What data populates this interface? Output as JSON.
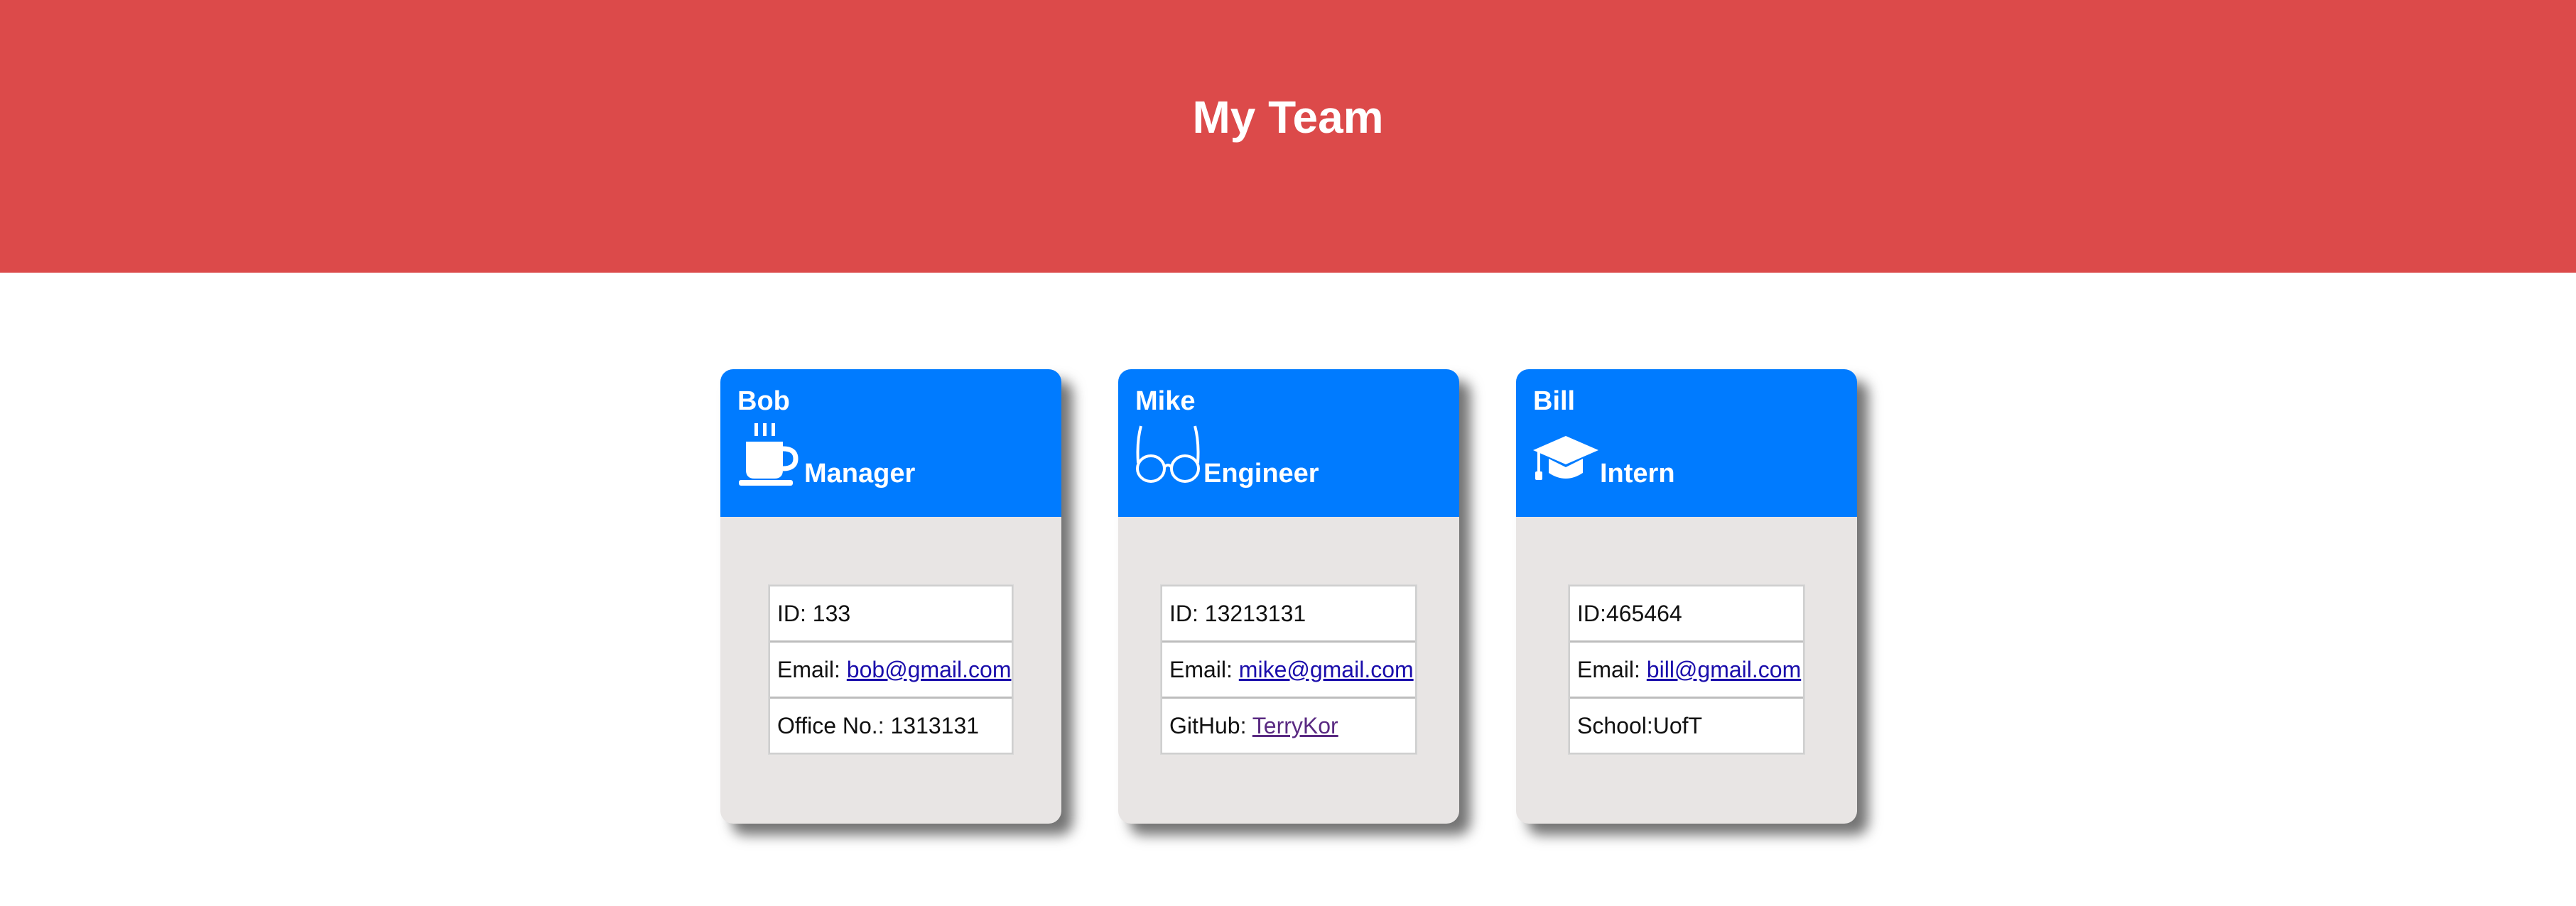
{
  "header": {
    "title": "My Team"
  },
  "cards": [
    {
      "name": "Bob",
      "role": "Manager",
      "icon": "coffee-cup-icon",
      "rows": [
        {
          "label": "ID: ",
          "value": "133",
          "link": false
        },
        {
          "label": "Email: ",
          "value": "bob@gmail.com",
          "link": true
        },
        {
          "label": "Office No.: ",
          "value": "1313131",
          "link": false
        }
      ]
    },
    {
      "name": "Mike",
      "role": "Engineer",
      "icon": "glasses-icon",
      "rows": [
        {
          "label": "ID: ",
          "value": "13213131",
          "link": false
        },
        {
          "label": "Email: ",
          "value": "mike@gmail.com",
          "link": true
        },
        {
          "label": "GitHub: ",
          "value": "TerryKor",
          "link": true
        }
      ]
    },
    {
      "name": "Bill",
      "role": "Intern",
      "icon": "graduation-cap-icon",
      "rows": [
        {
          "label": "ID:",
          "value": "465464",
          "link": false
        },
        {
          "label": "Email: ",
          "value": "bill@gmail.com",
          "link": true
        },
        {
          "label": "School:",
          "value": "UofT",
          "link": false
        }
      ]
    }
  ],
  "colors": {
    "header_bg": "#dc4a4a",
    "card_head_bg": "#007bff",
    "card_body_bg": "#e8e5e4",
    "link": "#1a0dab",
    "visited_link": "#5a2a82"
  }
}
